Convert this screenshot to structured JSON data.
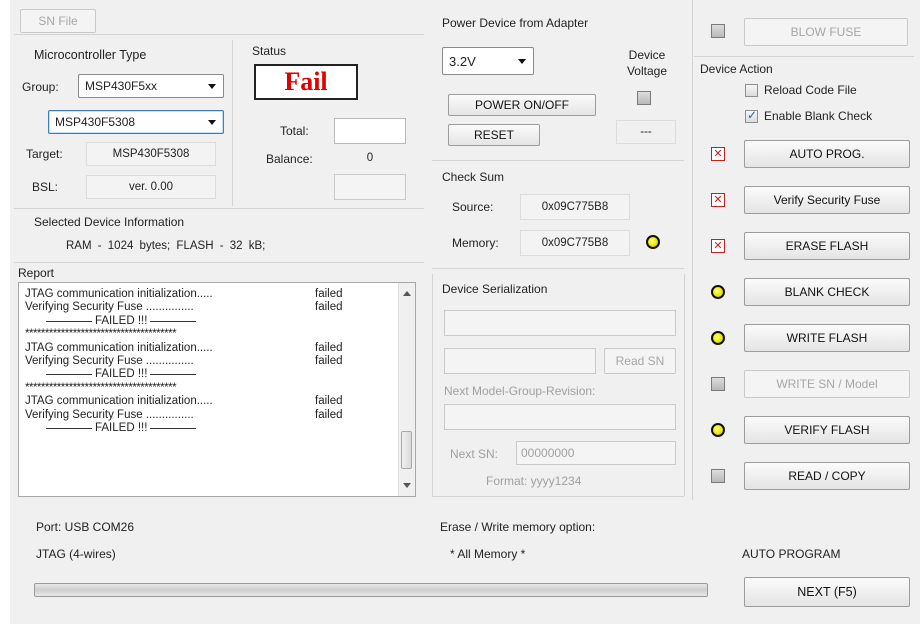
{
  "top": {
    "sn_file_label": "SN File"
  },
  "micro": {
    "title": "Microcontroller Type",
    "group_label": "Group:",
    "group_value": "MSP430F5xx",
    "device_value": "MSP430F5308",
    "target_label": "Target:",
    "target_value": "MSP430F5308",
    "bsl_label": "BSL:",
    "bsl_value": "ver. 0.00"
  },
  "status": {
    "title": "Status",
    "value": "Fail",
    "total_label": "Total:",
    "total_value": "",
    "balance_label": "Balance:",
    "balance_value": "0",
    "color": "#e00000"
  },
  "device_info": {
    "title": "Selected Device Information",
    "text": "RAM - 1024 bytes;   FLASH - 32 kB;"
  },
  "power": {
    "title": "Power Device from Adapter",
    "voltage": "3.2V",
    "device_voltage_label": "Device Voltage",
    "power_button": "POWER ON/OFF",
    "reset_button": "RESET",
    "voltage_readout": "---"
  },
  "checksum": {
    "title": "Check Sum",
    "source_label": "Source:",
    "source_value": "0x09C775B8",
    "memory_label": "Memory:",
    "memory_value": "0x09C775B8"
  },
  "report": {
    "title": "Report",
    "lines": [
      {
        "text": "JTAG communication initialization.....",
        "result": "failed"
      },
      {
        "text": "Verifying Security Fuse ...............",
        "result": "failed"
      },
      {
        "text": "FAILED !!!",
        "result": ""
      },
      {
        "text": "**************************************",
        "result": ""
      },
      {
        "text": "JTAG communication initialization.....",
        "result": "failed"
      },
      {
        "text": "Verifying Security Fuse ...............",
        "result": "failed"
      },
      {
        "text": "FAILED !!!",
        "result": ""
      },
      {
        "text": "**************************************",
        "result": ""
      },
      {
        "text": "JTAG communication initialization.....",
        "result": "failed"
      },
      {
        "text": "Verifying Security Fuse ...............",
        "result": "failed"
      },
      {
        "text": "FAILED !!!",
        "result": ""
      }
    ]
  },
  "serialization": {
    "title": "Device Serialization",
    "read_sn_button": "Read SN",
    "next_model_label": "Next Model-Group-Revision:",
    "next_sn_label": "Next SN:",
    "next_sn_value": "00000000",
    "format_label": "Format: yyyy1234"
  },
  "actions": {
    "blow_fuse": "BLOW FUSE",
    "title": "Device Action",
    "reload_code_label": "Reload Code File",
    "enable_blank_label": "Enable Blank Check",
    "reload_checked": false,
    "enable_blank_checked": true,
    "buttons": [
      {
        "label": "AUTO PROG.",
        "indicator": "x",
        "enabled": true
      },
      {
        "label": "Verify Security Fuse",
        "indicator": "x",
        "enabled": true
      },
      {
        "label": "ERASE FLASH",
        "indicator": "x",
        "enabled": true
      },
      {
        "label": "BLANK CHECK",
        "indicator": "yellow",
        "enabled": true
      },
      {
        "label": "WRITE FLASH",
        "indicator": "yellow",
        "enabled": true
      },
      {
        "label": "WRITE SN / Model",
        "indicator": "gray",
        "enabled": false
      },
      {
        "label": "VERIFY FLASH",
        "indicator": "yellow",
        "enabled": true
      },
      {
        "label": "READ / COPY",
        "indicator": "gray",
        "enabled": true
      }
    ]
  },
  "footer": {
    "port": "Port: USB COM26",
    "jtag": "JTAG (4-wires)",
    "erase_title": "Erase / Write memory option:",
    "erase_value": "* All Memory *",
    "auto_program_label": "AUTO PROGRAM",
    "next_button": "NEXT  (F5)",
    "progress": 0
  }
}
